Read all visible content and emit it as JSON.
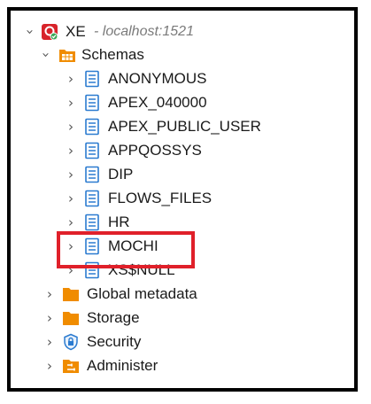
{
  "colors": {
    "highlight": "#e0202a",
    "folder": "#f08c00",
    "schema_icon": "#2b7bd0",
    "connection": "#d8232a"
  },
  "connection": {
    "name": "XE",
    "detail": "- localhost:1521",
    "icon": "database-connection-icon"
  },
  "schemas_folder": {
    "label": "Schemas",
    "icon": "schemas-folder-icon"
  },
  "schemas": [
    {
      "label": "ANONYMOUS"
    },
    {
      "label": "APEX_040000"
    },
    {
      "label": "APEX_PUBLIC_USER"
    },
    {
      "label": "APPQOSSYS"
    },
    {
      "label": "DIP"
    },
    {
      "label": "FLOWS_FILES"
    },
    {
      "label": "HR"
    },
    {
      "label": "MOCHI"
    },
    {
      "label": "XS$NULL"
    }
  ],
  "root_folders": [
    {
      "label": "Global metadata",
      "icon": "folder-icon"
    },
    {
      "label": "Storage",
      "icon": "folder-icon"
    },
    {
      "label": "Security",
      "icon": "security-shield-icon"
    },
    {
      "label": "Administer",
      "icon": "administer-icon"
    }
  ],
  "highlighted_item": "MOCHI"
}
